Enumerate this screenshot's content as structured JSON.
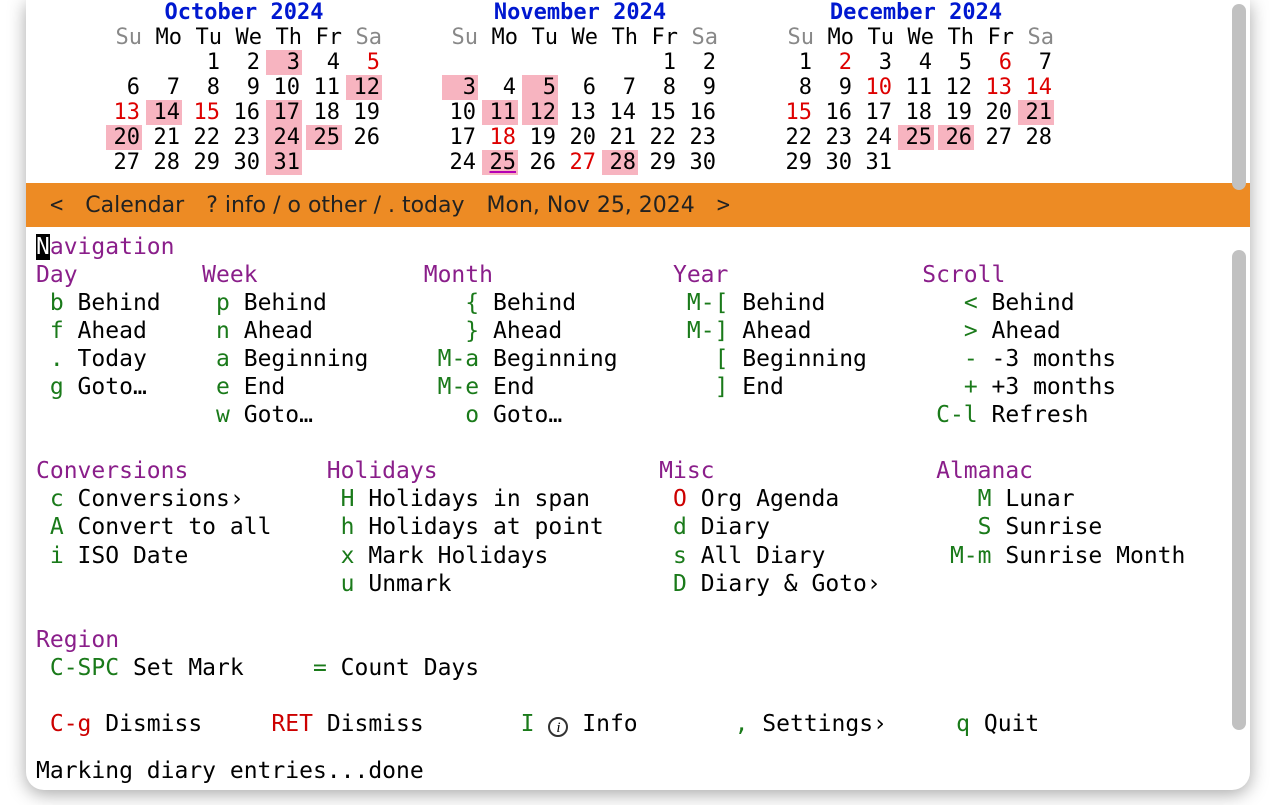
{
  "months": [
    {
      "title": "October 2024",
      "weeks": [
        [
          null,
          null,
          {
            "n": 1
          },
          {
            "n": 2
          },
          {
            "n": 3,
            "hl": true
          },
          {
            "n": 4
          },
          {
            "n": 5,
            "red": true
          }
        ],
        [
          {
            "n": 6
          },
          {
            "n": 7
          },
          {
            "n": 8
          },
          {
            "n": 9
          },
          {
            "n": 10
          },
          {
            "n": 11
          },
          {
            "n": 12,
            "hl": true
          }
        ],
        [
          {
            "n": 13,
            "red": true
          },
          {
            "n": 14,
            "hl": true
          },
          {
            "n": 15,
            "red": true
          },
          {
            "n": 16
          },
          {
            "n": 17,
            "hl": true
          },
          {
            "n": 18
          },
          {
            "n": 19
          }
        ],
        [
          {
            "n": 20,
            "hl": true
          },
          {
            "n": 21
          },
          {
            "n": 22
          },
          {
            "n": 23
          },
          {
            "n": 24,
            "hl": true
          },
          {
            "n": 25,
            "hl": true
          },
          {
            "n": 26
          }
        ],
        [
          {
            "n": 27
          },
          {
            "n": 28
          },
          {
            "n": 29
          },
          {
            "n": 30
          },
          {
            "n": 31,
            "hl": true
          },
          null,
          null
        ]
      ]
    },
    {
      "title": "November 2024",
      "weeks": [
        [
          null,
          null,
          null,
          null,
          null,
          {
            "n": 1
          },
          {
            "n": 2
          }
        ],
        [
          {
            "n": 3,
            "hl": true
          },
          {
            "n": 4
          },
          {
            "n": 5,
            "hl": true
          },
          {
            "n": 6
          },
          {
            "n": 7
          },
          {
            "n": 8
          },
          {
            "n": 9
          }
        ],
        [
          {
            "n": 10
          },
          {
            "n": 11,
            "hl": true
          },
          {
            "n": 12,
            "hl": true
          },
          {
            "n": 13
          },
          {
            "n": 14
          },
          {
            "n": 15
          },
          {
            "n": 16
          }
        ],
        [
          {
            "n": 17
          },
          {
            "n": 18,
            "red": true
          },
          {
            "n": 19
          },
          {
            "n": 20
          },
          {
            "n": 21
          },
          {
            "n": 22
          },
          {
            "n": 23
          }
        ],
        [
          {
            "n": 24
          },
          {
            "n": 25,
            "hl": true,
            "today": true
          },
          {
            "n": 26
          },
          {
            "n": 27,
            "red": true
          },
          {
            "n": 28,
            "hl": true
          },
          {
            "n": 29
          },
          {
            "n": 30
          }
        ]
      ]
    },
    {
      "title": "December 2024",
      "weeks": [
        [
          {
            "n": 1
          },
          {
            "n": 2,
            "red": true
          },
          {
            "n": 3
          },
          {
            "n": 4
          },
          {
            "n": 5
          },
          {
            "n": 6,
            "red": true
          },
          {
            "n": 7
          }
        ],
        [
          {
            "n": 8
          },
          {
            "n": 9
          },
          {
            "n": 10,
            "red": true
          },
          {
            "n": 11
          },
          {
            "n": 12
          },
          {
            "n": 13,
            "red": true
          },
          {
            "n": 14,
            "red": true
          }
        ],
        [
          {
            "n": 15,
            "red": true
          },
          {
            "n": 16
          },
          {
            "n": 17
          },
          {
            "n": 18
          },
          {
            "n": 19
          },
          {
            "n": 20
          },
          {
            "n": 21,
            "hl": true
          }
        ],
        [
          {
            "n": 22
          },
          {
            "n": 23
          },
          {
            "n": 24
          },
          {
            "n": 25,
            "hl": true
          },
          {
            "n": 26,
            "hl": true
          },
          {
            "n": 27
          },
          {
            "n": 28
          }
        ],
        [
          {
            "n": 29
          },
          {
            "n": 30
          },
          {
            "n": 31
          },
          null,
          null,
          null,
          null
        ]
      ]
    }
  ],
  "dow": [
    "Su",
    "Mo",
    "Tu",
    "We",
    "Th",
    "Fr",
    "Sa"
  ],
  "modeline": {
    "prev": "<",
    "title": "Calendar",
    "hints": "? info / o other / . today",
    "date": "Mon, Nov 25, 2024",
    "next": ">"
  },
  "nav": {
    "title": "Navigation",
    "cols": {
      "day": {
        "h": "Day",
        "rows": [
          [
            "b",
            "Behind"
          ],
          [
            "f",
            "Ahead"
          ],
          [
            ".",
            "Today"
          ],
          [
            "g",
            "Goto…"
          ]
        ]
      },
      "week": {
        "h": "Week",
        "rows": [
          [
            "p",
            "Behind"
          ],
          [
            "n",
            "Ahead"
          ],
          [
            "a",
            "Beginning"
          ],
          [
            "e",
            "End"
          ],
          [
            "w",
            "Goto…"
          ]
        ]
      },
      "month": {
        "h": "Month",
        "rows": [
          [
            "{",
            "Behind"
          ],
          [
            "}",
            "Ahead"
          ],
          [
            "M-a",
            "Beginning"
          ],
          [
            "M-e",
            "End"
          ],
          [
            "o",
            "Goto…"
          ]
        ]
      },
      "year": {
        "h": "Year",
        "rows": [
          [
            "M-[",
            "Behind"
          ],
          [
            "M-]",
            "Ahead"
          ],
          [
            "[",
            "Beginning"
          ],
          [
            "]",
            "End"
          ]
        ]
      },
      "scroll": {
        "h": "Scroll",
        "rows": [
          [
            "<",
            "Behind"
          ],
          [
            ">",
            "Ahead"
          ],
          [
            "-",
            "-3 months"
          ],
          [
            "+",
            "+3 months"
          ],
          [
            "C-l",
            "Refresh"
          ]
        ]
      }
    }
  },
  "groups": {
    "conv": {
      "h": "Conversions",
      "rows": [
        [
          "c",
          "Conversions›"
        ],
        [
          "A",
          "Convert to all"
        ],
        [
          "i",
          "ISO Date"
        ]
      ]
    },
    "hol": {
      "h": "Holidays",
      "rows": [
        [
          "H",
          "Holidays in span"
        ],
        [
          "h",
          "Holidays at point"
        ],
        [
          "x",
          "Mark Holidays"
        ],
        [
          "u",
          "Unmark"
        ]
      ]
    },
    "misc": {
      "h": "Misc",
      "rows": [
        [
          "O",
          "Org Agenda",
          "r"
        ],
        [
          "d",
          "Diary"
        ],
        [
          "s",
          "All Diary"
        ],
        [
          "D",
          "Diary & Goto›"
        ]
      ]
    },
    "alm": {
      "h": "Almanac",
      "rows": [
        [
          "M",
          "Lunar"
        ],
        [
          "S",
          "Sunrise"
        ],
        [
          "M-m",
          "Sunrise Month"
        ]
      ]
    }
  },
  "region": {
    "h": "Region",
    "rows": [
      [
        "C-SPC",
        "Set Mark"
      ],
      [
        "=",
        "Count Days"
      ]
    ]
  },
  "footer": [
    [
      "C-g",
      "Dismiss",
      "r"
    ],
    [
      "RET",
      "Dismiss",
      "r"
    ],
    [
      "I",
      "ⓘ Info"
    ],
    [
      ",",
      "Settings›"
    ],
    [
      "q",
      "Quit"
    ]
  ],
  "echo": "Marking diary entries...done"
}
